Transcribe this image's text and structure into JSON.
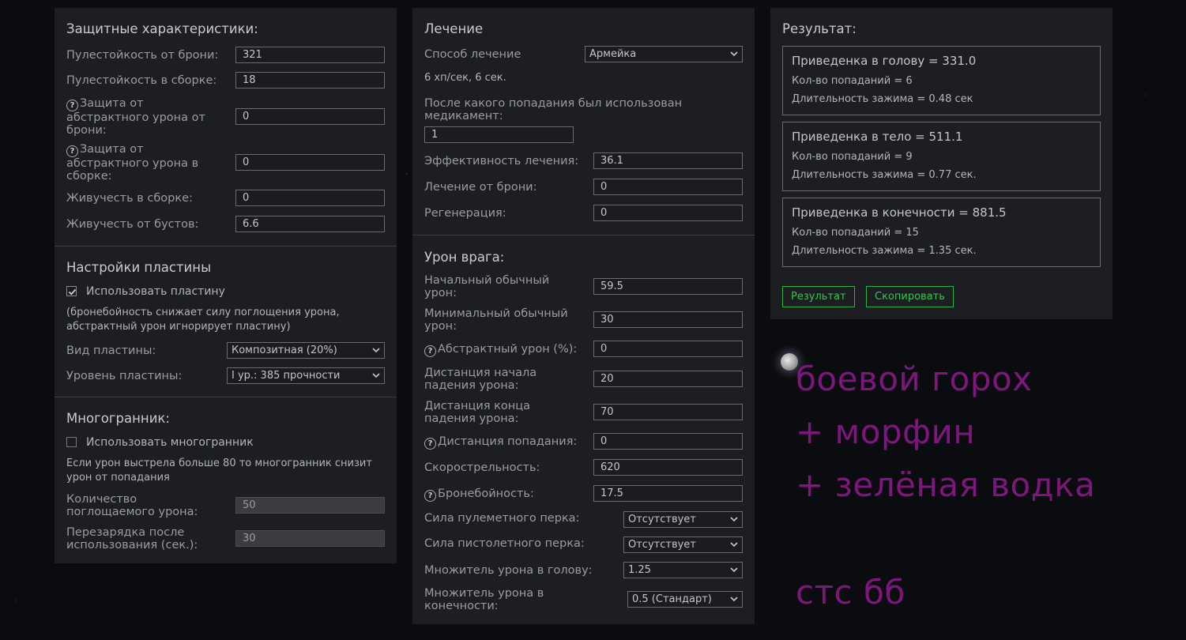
{
  "defense": {
    "title": "Защитные характеристики:",
    "armor_bullet": {
      "label": "Пулестойкость от брони:",
      "value": "321"
    },
    "build_bullet": {
      "label": "Пулестойкость в сборке:",
      "value": "18"
    },
    "armor_abstract": {
      "label": "Защита от абстрактного урона от брони:",
      "value": "0"
    },
    "build_abstract": {
      "label": "Защита от абстрактного урона в сборке:",
      "value": "0"
    },
    "build_vitality": {
      "label": "Живучесть в сборке:",
      "value": "0"
    },
    "boost_vitality": {
      "label": "Живучесть от бустов:",
      "value": "6.6"
    }
  },
  "plate": {
    "title": "Настройки пластины",
    "use_label": "Использовать пластину",
    "use_checked": true,
    "note": "(бронебойность снижает силу поглощения урона, абстрактный урон игнорирует пластину)",
    "type": {
      "label": "Вид пластины:",
      "value": "Композитная (20%)"
    },
    "level": {
      "label": "Уровень пластины:",
      "value": "I ур.: 385 прочности"
    }
  },
  "polyhedron": {
    "title": "Многогранник:",
    "use_label": "Использовать многогранник",
    "use_checked": false,
    "note": "Если урон выстрела больше 80 то многогранник снизит урон от попадания",
    "absorb": {
      "label": "Количество поглощаемого урона:",
      "value": "50"
    },
    "cooldown": {
      "label": "Перезарядка после использования (сек.):",
      "value": "30"
    }
  },
  "healing": {
    "title": "Лечение",
    "method": {
      "label": "Способ лечение",
      "value": "Армейка"
    },
    "method_info": "6 хп/сек, 6 сек.",
    "after_hit": {
      "label": "После какого попадания был использован медикамент:",
      "value": "1"
    },
    "efficiency": {
      "label": "Эффективность лечения:",
      "value": "36.1"
    },
    "armor_heal": {
      "label": "Лечение от брони:",
      "value": "0"
    },
    "regen": {
      "label": "Регенерация:",
      "value": "0"
    }
  },
  "enemy": {
    "title": "Урон врага:",
    "start_dmg": {
      "label": "Начальный обычный урон:",
      "value": "59.5"
    },
    "min_dmg": {
      "label": "Минимальный обычный урон:",
      "value": "30"
    },
    "abstract_dmg": {
      "label": "Абстрактный урон (%):",
      "value": "0"
    },
    "falloff_start": {
      "label": "Дистанция начала падения урона:",
      "value": "20"
    },
    "falloff_end": {
      "label": "Дистанция конца падения урона:",
      "value": "70"
    },
    "hit_distance": {
      "label": "Дистанция попадания:",
      "value": "0"
    },
    "fire_rate": {
      "label": "Скорострельность:",
      "value": "620"
    },
    "penetration": {
      "label": "Бронебойность:",
      "value": "17.5"
    },
    "mg_perk": {
      "label": "Сила пулеметного перка:",
      "value": "Отсутствует"
    },
    "pistol_perk": {
      "label": "Сила пистолетного перка:",
      "value": "Отсутствует"
    },
    "head_mult": {
      "label": "Множитель урона в голову:",
      "value": "1.25"
    },
    "limb_mult": {
      "label": "Множитель урона в конечности:",
      "value": "0.5 (Стандарт)"
    }
  },
  "result": {
    "title": "Результат:",
    "head": {
      "title": "Приведенка в голову = 331.0",
      "hits": "Кол-во попаданий = 6",
      "duration": "Длительность зажима = 0.48 сек"
    },
    "body": {
      "title": "Приведенка в тело = 511.1",
      "hits": "Кол-во попаданий = 9",
      "duration": "Длительность зажима = 0.77 сек."
    },
    "limbs": {
      "title": "Приведенка в конечности = 881.5",
      "hits": "Кол-во попаданий = 15",
      "duration": "Длительность зажима = 1.35 сек."
    },
    "result_button": "Результат",
    "copy_button": "Скопировать"
  },
  "note": {
    "line1": "боевой горох",
    "line2": "+ морфин",
    "line3": "+ зелёная водка",
    "line4": "стс бб"
  },
  "colors": {
    "accent_green": "#35c451",
    "handwriting": "#7e167e",
    "panel": "#1c1e22"
  }
}
